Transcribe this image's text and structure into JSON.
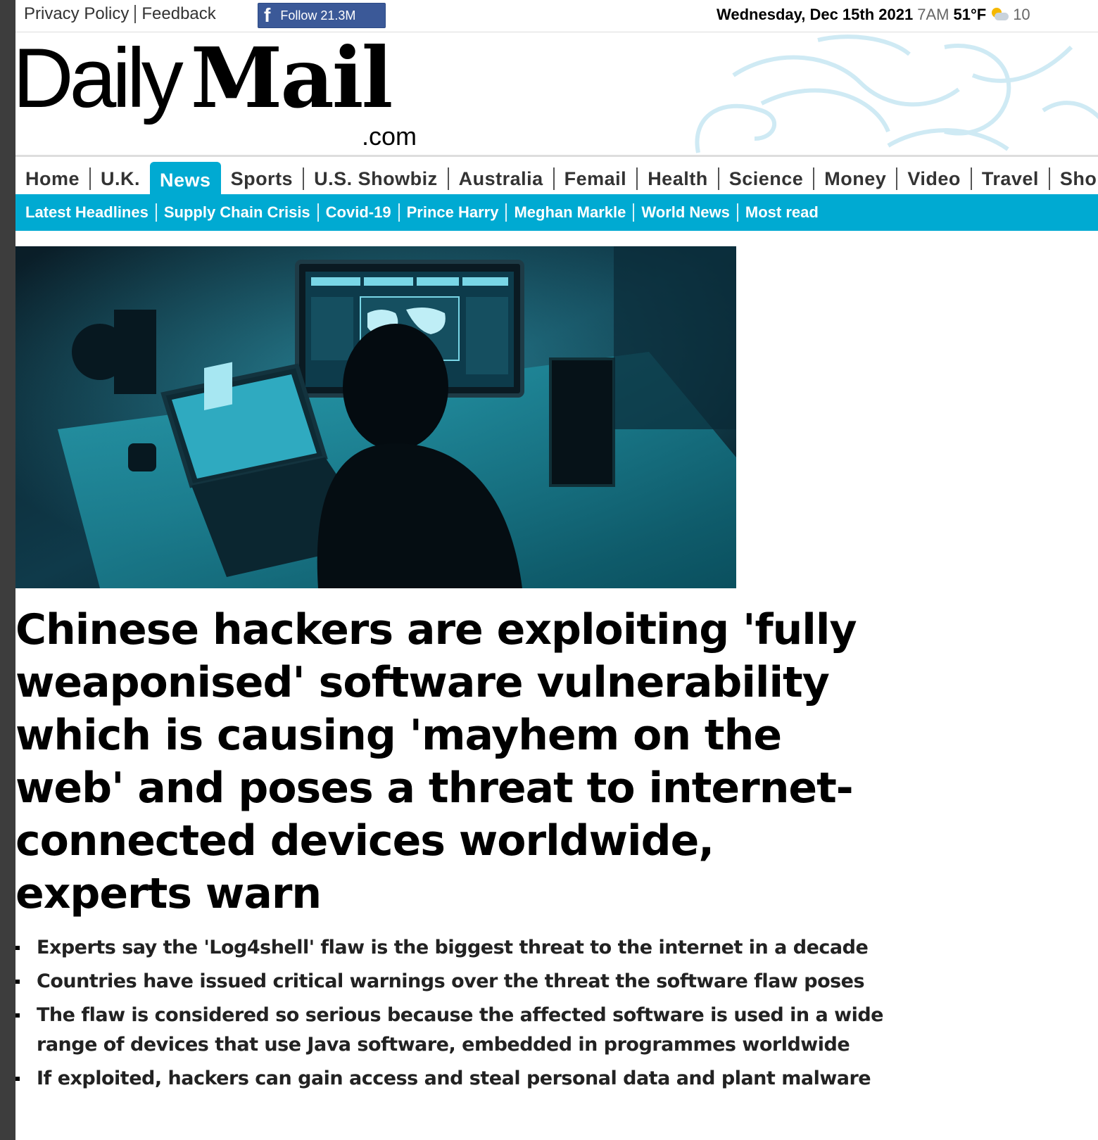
{
  "topbar": {
    "links": [
      "Privacy Policy",
      "Feedback"
    ],
    "facebook_label": "Follow 21.3M",
    "date": "Wednesday, Dec 15th 2021",
    "time": "7AM",
    "temperature": "51°F",
    "weather_icon": "partly-cloudy-icon",
    "overflow_text": "10"
  },
  "masthead": {
    "logo_daily": "Daily",
    "logo_mail": "Mail",
    "logo_com": ".com"
  },
  "nav": {
    "items": [
      "Home",
      "U.K.",
      "News",
      "Sports",
      "U.S. Showbiz",
      "Australia",
      "Femail",
      "Health",
      "Science",
      "Money",
      "Video",
      "Travel",
      "Sho"
    ],
    "active": "News"
  },
  "subnav": {
    "items": [
      "Latest Headlines",
      "Supply Chain Crisis",
      "Covid-19",
      "Prince Harry",
      "Meghan Markle",
      "World News",
      "Most read"
    ]
  },
  "article": {
    "headline": "Chinese hackers are exploiting 'fully weaponised' software vulnerability which is causing 'mayhem on the web' and poses a threat to internet-connected devices worldwide, experts warn",
    "bullets": [
      "Experts say the 'Log4shell' flaw is the biggest threat to the internet in a decade",
      "Countries have issued critical warnings over the threat the software flaw poses",
      "The flaw is considered so serious because the affected software is used in a wide range of devices that use Java software, embedded in programmes worldwide",
      "If exploited, hackers can gain access and steal personal data and plant malware"
    ]
  },
  "colors": {
    "accent": "#00aad2",
    "facebook": "#3b5998",
    "rail": "#3d3d3d"
  }
}
